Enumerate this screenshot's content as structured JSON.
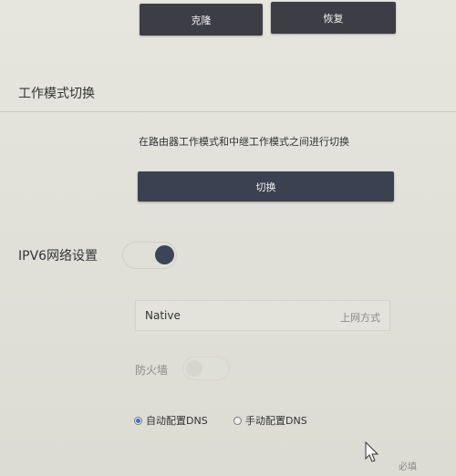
{
  "backup_section": {
    "clone_label": "克隆",
    "restore_label": "恢复"
  },
  "work_mode": {
    "title": "工作模式切换",
    "description": "在路由器工作模式和中继工作模式之间进行切换",
    "switch_label": "切换"
  },
  "ipv6": {
    "title": "IPV6网络设置",
    "enabled": true,
    "connection_type_value": "Native",
    "connection_type_label": "上网方式",
    "firewall_label": "防火墙",
    "firewall_enabled": false,
    "dns_options": [
      {
        "label": "自动配置DNS",
        "selected": true
      },
      {
        "label": "手动配置DNS",
        "selected": false
      }
    ]
  },
  "footer": {
    "partial_label": "必填"
  },
  "colors": {
    "button_dark": "#3d3d45",
    "button_primary": "#3a4150",
    "toggle_on": "#3a4556",
    "radio_selected": "#3b6fd0"
  }
}
